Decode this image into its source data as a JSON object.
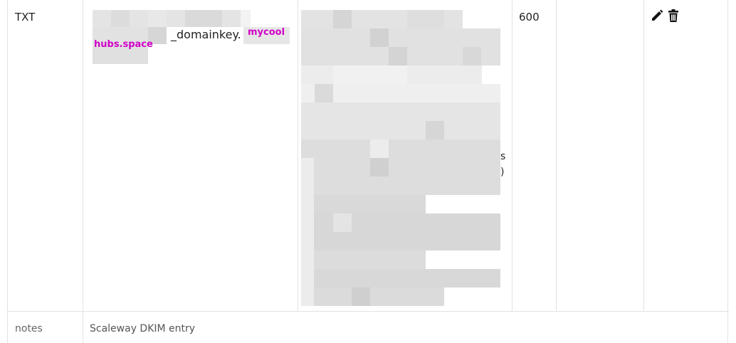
{
  "record": {
    "type": "TXT",
    "name_suffix": "_domainkey.",
    "highlight_top": "mycool",
    "highlight_bottom": "hubs.space",
    "ttl": "600",
    "value_fragment_1": "s",
    "value_fragment_2": ")"
  },
  "actions": {
    "edit_icon": "pencil-icon",
    "delete_icon": "trash-icon"
  },
  "notes": {
    "label": "notes",
    "value": "Scaleway DKIM entry"
  },
  "colors": {
    "highlight": "#d100c8",
    "border": "#e3e3e3"
  }
}
